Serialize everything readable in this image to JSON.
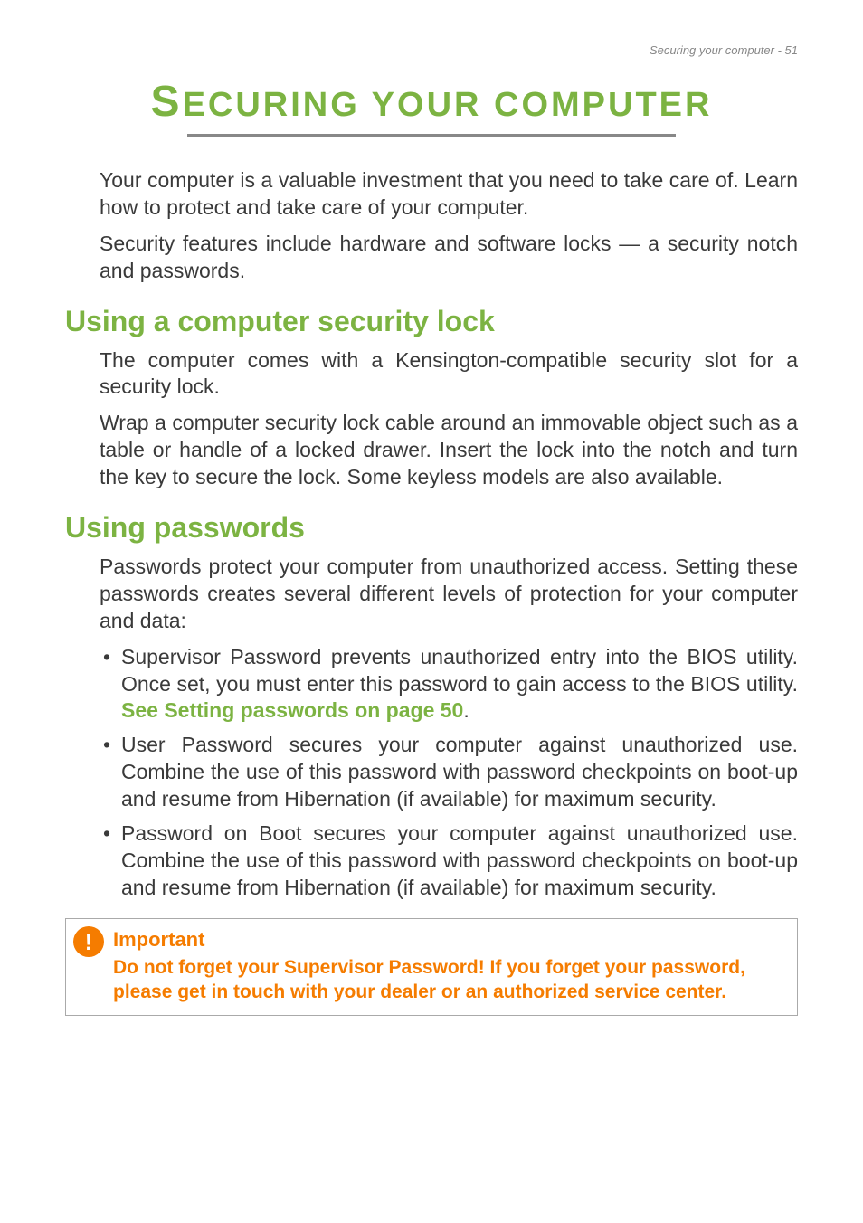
{
  "header": {
    "running_head": "Securing your computer - 51"
  },
  "title": {
    "first_cap": "S",
    "rest": "ECURING YOUR COMPUTER"
  },
  "intro": {
    "p1": "Your computer is a valuable investment that you need to take care of. Learn how to protect and take care of your computer.",
    "p2": "Security features include hardware and software locks — a security notch and passwords."
  },
  "section1": {
    "heading": "Using a computer security lock",
    "p1": "The computer comes with a Kensington-compatible security slot for a security lock.",
    "p2": "Wrap a computer security lock cable around an immovable object such as a table or handle of a locked drawer. Insert the lock into the notch and turn the key to secure the lock. Some keyless models are also available."
  },
  "section2": {
    "heading": "Using passwords",
    "p1": "Passwords protect your computer from unauthorized access. Setting these passwords creates several different levels of protection for your computer and data:",
    "bullets": [
      {
        "pre": "Supervisor Password prevents unauthorized entry into the BIOS utility. Once set, you must enter this password to gain access to the BIOS utility. ",
        "link": "See Setting passwords on page 50",
        "post": "."
      },
      {
        "pre": "User Password secures your computer against unauthorized use. Combine the use of this password with password checkpoints on boot-up and resume from Hibernation (if available) for maximum security.",
        "link": "",
        "post": ""
      },
      {
        "pre": "Password on Boot secures your computer against unauthorized use. Combine the use of this password with password checkpoints on boot-up and resume from Hibernation (if available) for maximum security.",
        "link": "",
        "post": ""
      }
    ]
  },
  "callout": {
    "icon": "!",
    "title": "Important",
    "body": "Do not forget your Supervisor Password! If you forget your password, please get in touch with your dealer or an authorized service center."
  }
}
